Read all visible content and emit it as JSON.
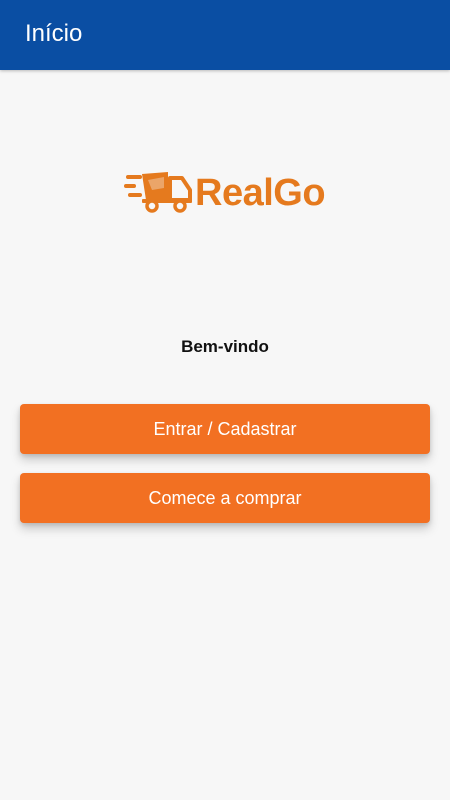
{
  "app_bar": {
    "title": "Início",
    "color": "#0a4ea3"
  },
  "logo": {
    "text": "RealGo",
    "icon": "delivery-truck-icon",
    "color": "#e57a1e"
  },
  "welcome": {
    "text": "Bem-vindo"
  },
  "actions": {
    "login_label": "Entrar / Cadastrar",
    "shop_label": "Comece a comprar",
    "button_color": "#f27022"
  }
}
